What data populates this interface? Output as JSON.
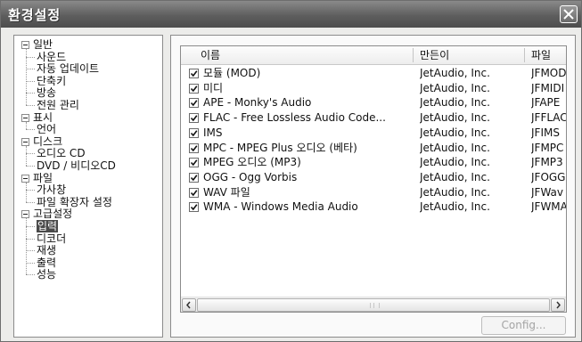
{
  "window": {
    "title": "환경설정"
  },
  "tree": {
    "groups": [
      {
        "label": "일반",
        "children": [
          "사운드",
          "자동 업데이트",
          "단축키",
          "방송",
          "전원 관리"
        ]
      },
      {
        "label": "표시",
        "children": [
          "언어"
        ]
      },
      {
        "label": "디스크",
        "children": [
          "오디오 CD",
          "DVD / 비디오CD"
        ]
      },
      {
        "label": "파일",
        "children": [
          "가사창",
          "파일 확장자 설정"
        ]
      },
      {
        "label": "고급설정",
        "children": [
          "입력",
          "디코더",
          "재생",
          "출력",
          "성능"
        ]
      }
    ],
    "selected": "입력"
  },
  "list": {
    "columns": [
      "이름",
      "만든이",
      "파일"
    ],
    "rows": [
      {
        "name": "모듈 (MOD)",
        "author": "JetAudio, Inc.",
        "file": "JFMOD",
        "checked": true
      },
      {
        "name": "미디",
        "author": "JetAudio, Inc.",
        "file": "JFMIDI",
        "checked": true
      },
      {
        "name": "APE - Monky's Audio",
        "author": "JetAudio, Inc.",
        "file": "JFAPE",
        "checked": true
      },
      {
        "name": "FLAC - Free Lossless Audio Code...",
        "author": "JetAudio, Inc.",
        "file": "JFFLAC",
        "checked": true
      },
      {
        "name": "IMS",
        "author": "JetAudio, Inc.",
        "file": "JFIMS",
        "checked": true
      },
      {
        "name": "MPC - MPEG Plus 오디오 (베타)",
        "author": "JetAudio, Inc.",
        "file": "JFMPC",
        "checked": true
      },
      {
        "name": "MPEG 오디오 (MP3)",
        "author": "JetAudio, Inc.",
        "file": "JFMP3",
        "checked": true
      },
      {
        "name": "OGG - Ogg Vorbis",
        "author": "JetAudio, Inc.",
        "file": "JFOGG",
        "checked": true
      },
      {
        "name": "WAV 파일",
        "author": "JetAudio, Inc.",
        "file": "JFWav",
        "checked": true
      },
      {
        "name": "WMA - Windows Media Audio",
        "author": "JetAudio, Inc.",
        "file": "JFWMA",
        "checked": true
      }
    ]
  },
  "buttons": {
    "config": "Config..."
  }
}
